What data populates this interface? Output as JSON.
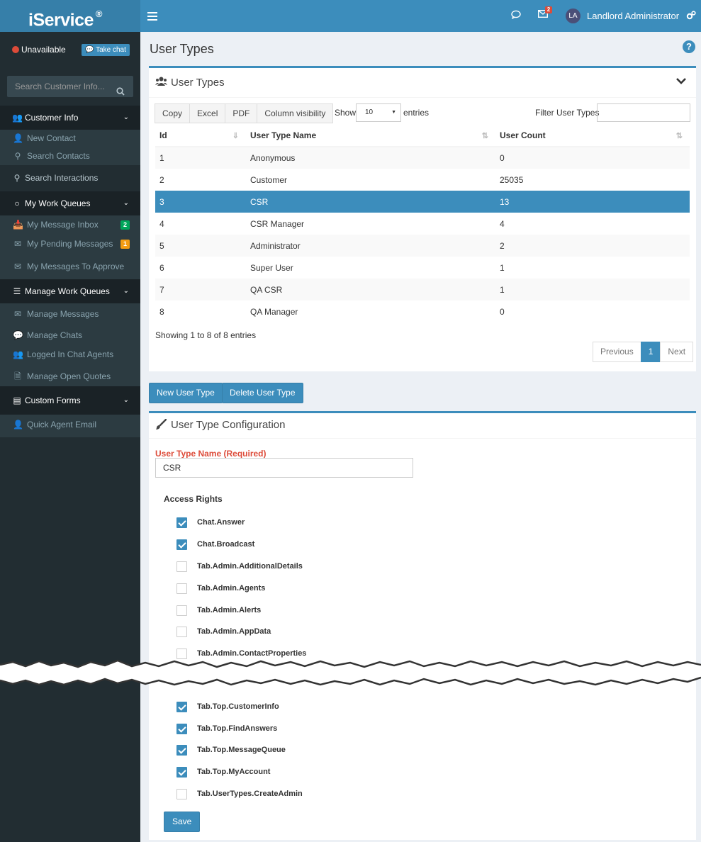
{
  "header": {
    "logo": "iService",
    "logo_mark": "®",
    "mail_badge": "2",
    "avatar_initials": "LA",
    "username": "Landlord Administrator"
  },
  "sidebar": {
    "status": "Unavailable",
    "take_chat": "Take chat",
    "search_placeholder": "Search Customer Info...",
    "menu": [
      {
        "label": "Customer Info",
        "icon": "users-icon"
      },
      {
        "label": "New Contact",
        "icon": "add-user-icon"
      },
      {
        "label": "Search Contacts",
        "icon": "search-icon"
      },
      {
        "label": "Search Interactions",
        "icon": "search-icon"
      },
      {
        "label": "My Work Queues",
        "icon": "circle-icon"
      },
      {
        "label": "My Message Inbox",
        "icon": "inbox-icon",
        "badge": "2",
        "badge_color": "#00a65a"
      },
      {
        "label": "My Pending Messages",
        "icon": "envelope-clock-icon",
        "badge": "1",
        "badge_color": "#f39c12"
      },
      {
        "label": "My Messages To Approve",
        "icon": "envelope-check-icon"
      },
      {
        "label": "Manage Work Queues",
        "icon": "queues-icon"
      },
      {
        "label": "Manage Messages",
        "icon": "envelope-gear-icon"
      },
      {
        "label": "Manage Chats",
        "icon": "chat-icon"
      },
      {
        "label": "Logged In Chat Agents",
        "icon": "agents-icon"
      },
      {
        "label": "Manage Open Quotes",
        "icon": "quote-icon"
      },
      {
        "label": "Custom Forms",
        "icon": "form-icon"
      },
      {
        "label": "Quick Agent Email",
        "icon": "agent-email-icon"
      }
    ]
  },
  "page": {
    "title": "User Types"
  },
  "user_types_box": {
    "title": "User Types",
    "buttons": [
      "Copy",
      "Excel",
      "PDF",
      "Column visibility"
    ],
    "show_label": "Show",
    "show_value": "10",
    "entries_label": "entries",
    "filter_label": "Filter User Types",
    "columns": [
      "Id",
      "User Type Name",
      "User Count"
    ],
    "rows": [
      [
        "1",
        "Anonymous",
        "0"
      ],
      [
        "2",
        "Customer",
        "25035"
      ],
      [
        "3",
        "CSR",
        "13"
      ],
      [
        "4",
        "CSR Manager",
        "4"
      ],
      [
        "5",
        "Administrator",
        "2"
      ],
      [
        "6",
        "Super User",
        "1"
      ],
      [
        "7",
        "QA CSR",
        "1"
      ],
      [
        "8",
        "QA Manager",
        "0"
      ]
    ],
    "selected_row": 2,
    "showing": "Showing 1 to 8 of 8 entries",
    "pager": [
      "Previous",
      "1",
      "Next"
    ]
  },
  "actions": {
    "new": "New User Type",
    "delete": "Delete User Type"
  },
  "config": {
    "title": "User Type Configuration",
    "name_label": "User Type Name (Required)",
    "name_value": "CSR",
    "access_label": "Access Rights",
    "rights_top": [
      {
        "label": "Chat.Answer",
        "checked": true
      },
      {
        "label": "Chat.Broadcast",
        "checked": true
      },
      {
        "label": "Tab.Admin.AdditionalDetails",
        "checked": false
      },
      {
        "label": "Tab.Admin.Agents",
        "checked": false
      },
      {
        "label": "Tab.Admin.Alerts",
        "checked": false
      },
      {
        "label": "Tab.Admin.AppData",
        "checked": false
      },
      {
        "label": "Tab.Admin.ContactProperties",
        "checked": false
      }
    ],
    "rights_bottom": [
      {
        "label": "Tab.Top.CustomerInfo",
        "checked": true
      },
      {
        "label": "Tab.Top.FindAnswers",
        "checked": true
      },
      {
        "label": "Tab.Top.MessageQueue",
        "checked": true
      },
      {
        "label": "Tab.Top.MyAccount",
        "checked": true
      },
      {
        "label": "Tab.UserTypes.CreateAdmin",
        "checked": false
      }
    ],
    "save": "Save"
  },
  "colors": {
    "primary": "#3c8dbc",
    "sidebar": "#222d32",
    "danger": "#dd4b39"
  }
}
